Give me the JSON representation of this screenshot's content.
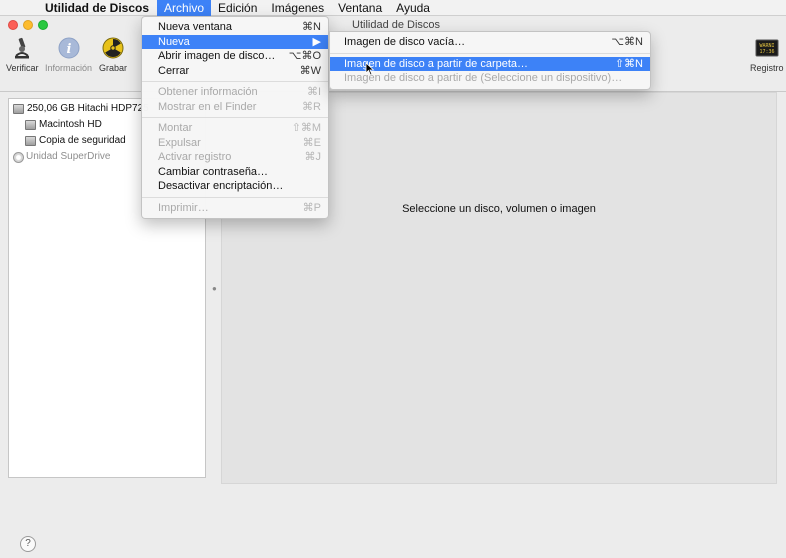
{
  "menubar": {
    "app_name": "Utilidad de Discos",
    "items": [
      "Archivo",
      "Edición",
      "Imágenes",
      "Ventana",
      "Ayuda"
    ]
  },
  "window": {
    "title": "Utilidad de Discos"
  },
  "toolbar": {
    "verificar": "Verificar",
    "informacion": "Información",
    "grabar": "Grabar",
    "registro": "Registro"
  },
  "sidebar": {
    "items": [
      {
        "label": "250,06 GB Hitachi HDP725"
      },
      {
        "label": "Macintosh HD"
      },
      {
        "label": "Copia de seguridad"
      },
      {
        "label": "Unidad SuperDrive"
      }
    ]
  },
  "main": {
    "message": "Seleccione un disco, volumen o imagen"
  },
  "archivo_menu": {
    "nueva_ventana": {
      "label": "Nueva ventana",
      "shortcut": "⌘N"
    },
    "nueva": {
      "label": "Nueva",
      "shortcut": "▶"
    },
    "abrir": {
      "label": "Abrir imagen de disco…",
      "shortcut": "⌥⌘O"
    },
    "cerrar": {
      "label": "Cerrar",
      "shortcut": "⌘W"
    },
    "obtener": {
      "label": "Obtener información",
      "shortcut": "⌘I"
    },
    "mostrar": {
      "label": "Mostrar en el Finder",
      "shortcut": "⌘R"
    },
    "montar": {
      "label": "Montar",
      "shortcut": "⇧⌘M"
    },
    "expulsar": {
      "label": "Expulsar",
      "shortcut": "⌘E"
    },
    "activar": {
      "label": "Activar registro",
      "shortcut": "⌘J"
    },
    "cambiar": {
      "label": "Cambiar contraseña…",
      "shortcut": ""
    },
    "desactivar": {
      "label": "Desactivar encriptación…",
      "shortcut": ""
    },
    "imprimir": {
      "label": "Imprimir…",
      "shortcut": "⌘P"
    }
  },
  "nueva_submenu": {
    "vacia": {
      "label": "Imagen de disco vacía…",
      "shortcut": "⌥⌘N"
    },
    "carpeta": {
      "label": "Imagen de disco a partir de carpeta…",
      "shortcut": "⇧⌘N"
    },
    "dispositivo": {
      "label": "Imagen de disco a partir de (Seleccione un dispositivo)…",
      "shortcut": ""
    }
  },
  "help": {
    "label": "?"
  },
  "colors": {
    "accent": "#3d82f7"
  },
  "icons": {
    "apple": "apple-logo-icon",
    "verificar": "microscope-icon",
    "informacion": "info-icon",
    "grabar": "burn-icon",
    "registro": "log-console-icon"
  }
}
